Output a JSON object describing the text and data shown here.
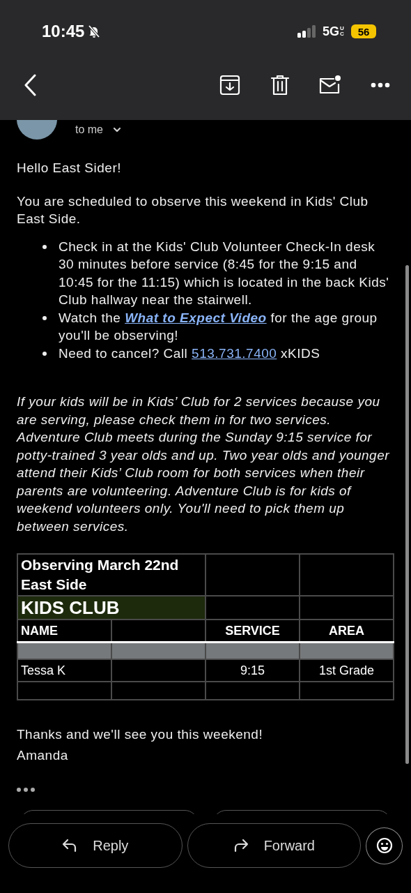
{
  "status_bar": {
    "time": "10:45",
    "network": "5G",
    "network_suffix": "UC",
    "battery": "56"
  },
  "sender": {
    "recipient": "to me"
  },
  "body": {
    "greeting": "Hello East Sider!",
    "intro": "You are scheduled to observe this weekend in Kids' Club East Side.",
    "bullets": [
      {
        "kind": "text",
        "before": "Check in at the Kids' Club Volunteer Check-In desk 30 minutes before service (8:45 for the 9:15 and 10:45 for the 11:15) which is located in the back Kids' Club hallway near the stairwell."
      },
      {
        "kind": "emphasis",
        "before": "Watch the ",
        "link": "What to Expect Video",
        "after": " for the age group you'll be observing!"
      },
      {
        "kind": "link",
        "before": "Need to cancel? Call ",
        "link": "513.731.7400",
        "after": " xKIDS"
      }
    ],
    "note": "If your kids will be in Kids’ Club for 2 services because you are serving, please check them in for two services. Adventure Club meets during the Sunday 9:15 service for potty-trained 3 year olds and up. Two year olds and younger attend their Kids’ Club room for both services when their parents are volunteering. Adventure Club is for kids of weekend volunteers only. You'll need to pick them up between services.",
    "table": {
      "title": "Observing March 22nd East Side",
      "banner": "KIDS CLUB",
      "columns": [
        "NAME",
        null,
        "SERVICE",
        "AREA"
      ],
      "rows": [
        {
          "kind": "shaded",
          "cells": [
            null,
            null,
            null,
            null
          ]
        },
        {
          "kind": "plain",
          "cells": [
            "Tessa K",
            null,
            "9:15",
            "1st Grade"
          ]
        },
        {
          "kind": "plain",
          "cells": [
            null,
            null,
            null,
            null
          ]
        }
      ]
    },
    "closing": "Thanks and we'll see you this weekend!",
    "signature": "Amanda"
  },
  "actions": [
    {
      "label": "Reply",
      "kind": "reply"
    },
    {
      "label": "Forward",
      "kind": "forward"
    }
  ]
}
